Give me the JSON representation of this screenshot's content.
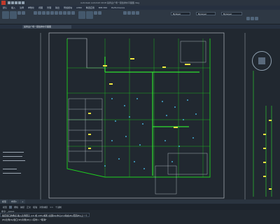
{
  "window": {
    "title": "Autodesk AutoCAD 2018  某商业广场一层给排水平面图.dwg"
  },
  "ribbon": {
    "tabs": [
      "默认",
      "插入",
      "注释",
      "参数化",
      "视图",
      "管理",
      "输出",
      "附加模块",
      "A360",
      "精选应用",
      "BIM 360",
      "Performance"
    ],
    "layer_value": "Bylayer",
    "color_value": "ByLayer",
    "linetype_value": "ByLayer"
  },
  "file_tab": {
    "label": "某商业广场一层给排水平面图"
  },
  "command": {
    "history": [
      "命令: 指定对角点或",
      "命令: _qsave"
    ],
    "prompt": "指定窗口的角点,输入比例因子 (nX 或 nXP),或者 [全部(A)/中心(C)/动态(D)/范围(E)/上一个(P)/比例(S)/窗口(W)/对象(O)] <实时>: *取消*"
  },
  "layout_tabs": [
    "模型",
    "布局1",
    "+"
  ],
  "status_bar": {
    "items": [
      "模型",
      "栅格",
      "捕捉",
      "正交",
      "极轴",
      "对象捕捉",
      "1:1",
      "十进制"
    ]
  },
  "colors": {
    "background": "#212830",
    "walls": "#1fd01f",
    "pipes": "#2fe02f",
    "sprinklers": "#4fd0ff",
    "annotations": "#f0e640"
  }
}
